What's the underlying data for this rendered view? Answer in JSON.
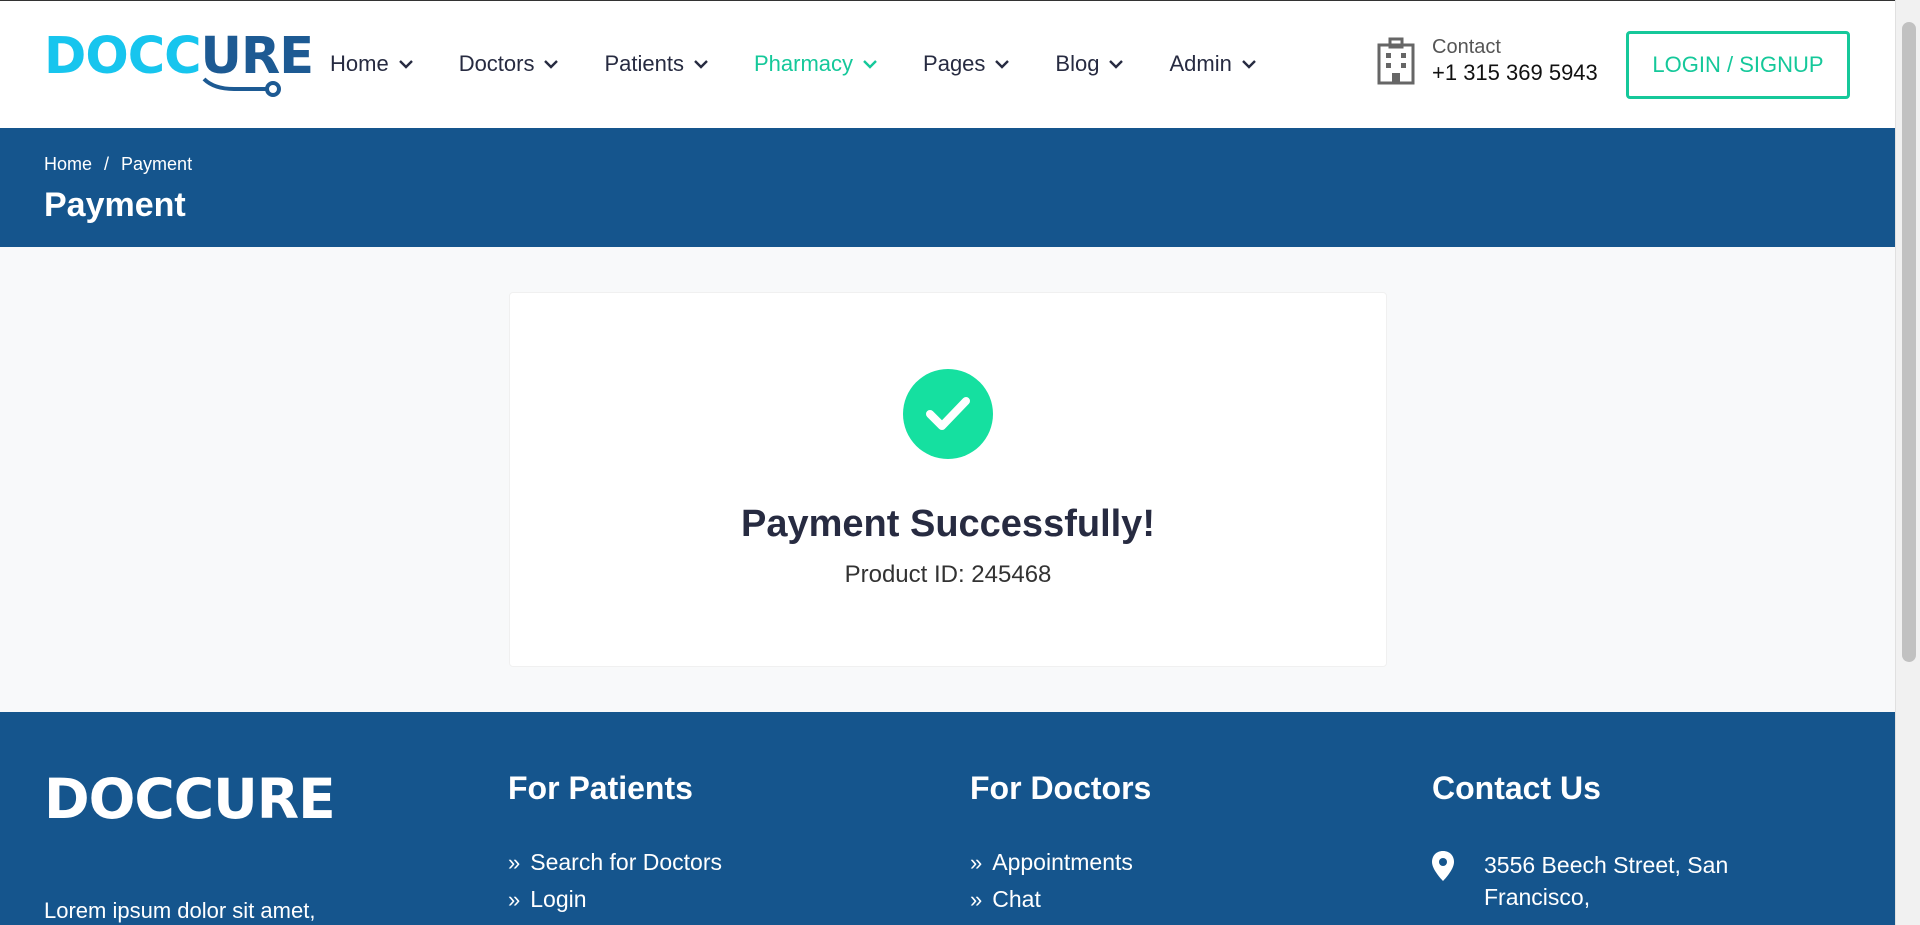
{
  "header": {
    "logo": {
      "part1": "DOCC",
      "part2": "U",
      "part3": "RE"
    },
    "nav": [
      {
        "label": "Home",
        "active": false
      },
      {
        "label": "Doctors",
        "active": false
      },
      {
        "label": "Patients",
        "active": false
      },
      {
        "label": "Pharmacy",
        "active": true
      },
      {
        "label": "Pages",
        "active": false
      },
      {
        "label": "Blog",
        "active": false
      },
      {
        "label": "Admin",
        "active": false
      }
    ],
    "contact": {
      "label": "Contact",
      "phone": "+1 315 369 5943",
      "icon": "hospital-icon"
    },
    "login_label": "LOGIN / SIGNUP"
  },
  "breadcrumb": {
    "items": [
      "Home",
      "Payment"
    ],
    "separator": "/",
    "title": "Payment"
  },
  "main": {
    "success_icon": "check-circle-icon",
    "title": "Payment Successfully!",
    "product_id": "Product ID: 245468"
  },
  "footer": {
    "logo": "DOCCURE",
    "description": "Lorem ipsum dolor sit amet,",
    "for_patients": {
      "title": "For Patients",
      "links": [
        "Search for Doctors",
        "Login"
      ]
    },
    "for_doctors": {
      "title": "For Doctors",
      "links": [
        "Appointments",
        "Chat"
      ]
    },
    "contact_us": {
      "title": "Contact Us",
      "address_line1": "3556 Beech Street, San",
      "address_line2": "Francisco,"
    }
  },
  "colors": {
    "accent": "#15c89a",
    "brand_blue": "#15558d",
    "logo_cyan": "#17c5ee",
    "success": "#15e0a0"
  }
}
